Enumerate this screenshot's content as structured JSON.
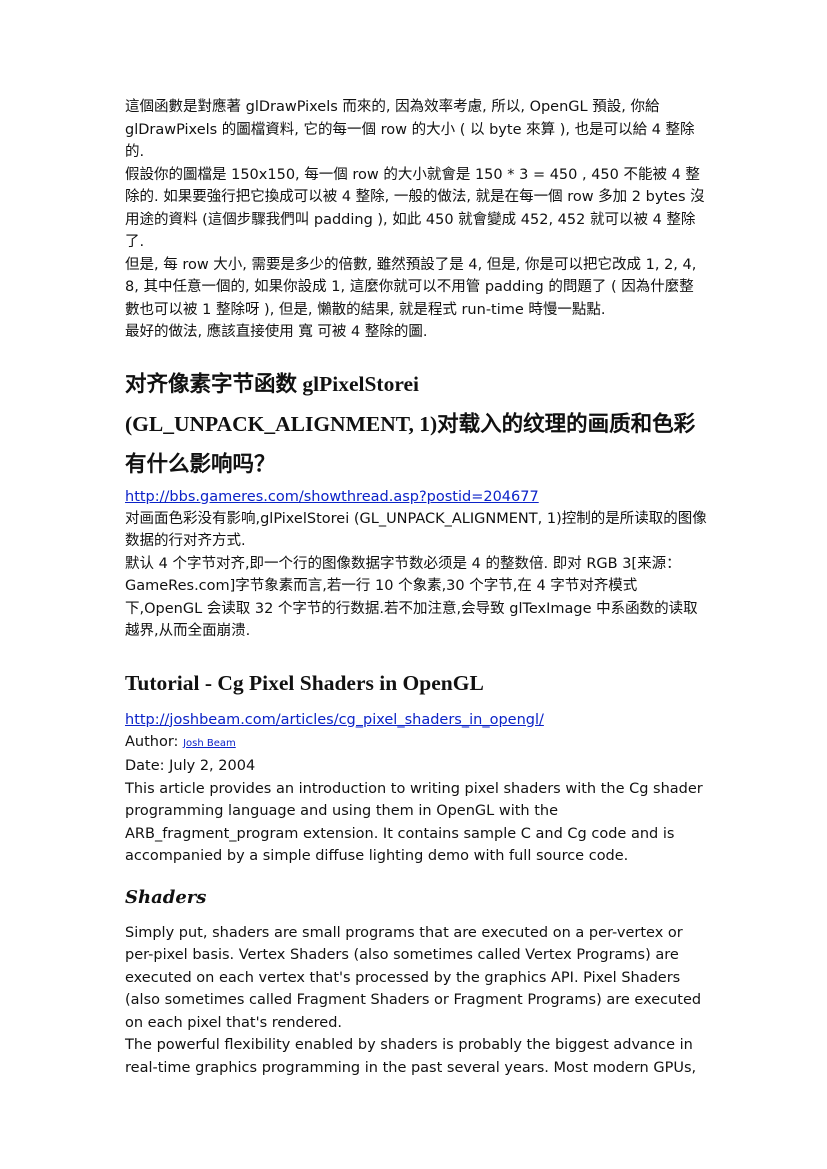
{
  "section1": {
    "paragraphs": [
      "這個函數是對應著 glDrawPixels 而來的, 因為效率考慮, 所以, OpenGL 預設, 你給 glDrawPixels 的圖檔資料, 它的每一個 row 的大小 ( 以 byte 來算 ), 也是可以給 4 整除的.",
      "假設你的圖檔是 150x150, 每一個 row 的大小就會是 150 * 3 = 450 , 450 不能被 4 整除的. 如果要強行把它換成可以被 4 整除, 一般的做法, 就是在每一個 row 多加 2 bytes 沒用途的資料 (這個步驟我們叫 padding ), 如此 450 就會變成 452, 452 就可以被 4 整除了.",
      "但是, 每 row 大小, 需要是多少的倍數, 雖然預設了是 4, 但是, 你是可以把它改成 1, 2, 4, 8, 其中任意一個的, 如果你設成 1, 這麼你就可以不用管 padding 的問題了 ( 因為什麼整數也可以被 1 整除呀 ), 但是, 懶散的結果, 就是程式 run-time 時慢一點點.",
      "最好的做法, 應該直接使用 寬 可被 4 整除的圖."
    ]
  },
  "section2": {
    "title": "对齐像素字节函数 glPixelStorei (GL_UNPACK_ALIGNMENT, 1)对载入的纹理的画质和色彩有什么影响吗？",
    "link": "http://bbs.gameres.com/showthread.asp?postid=204677",
    "paragraphs": [
      "对画面色彩没有影响,glPixelStorei (GL_UNPACK_ALIGNMENT, 1)控制的是所读取的图像数据的行对齐方式.",
      "默认 4 个字节对齐,即一个行的图像数据字节数必须是 4 的整数倍. 即对 RGB 3[来源：GameRes.com]字节象素而言,若一行 10 个象素,30 个字节,在 4 字节对齐模式下,OpenGL 会读取 32 个字节的行数据.若不加注意,会导致 glTexImage 中系函数的读取越界,从而全面崩溃."
    ]
  },
  "section3": {
    "title": "Tutorial - Cg Pixel Shaders in OpenGL",
    "link": "http://joshbeam.com/articles/cg_pixel_shaders_in_opengl/",
    "author_label": "Author:",
    "author_name": "Josh Beam",
    "date": "Date: July 2, 2004",
    "intro": "This article provides an introduction to writing pixel shaders with the Cg shader programming language and using them in OpenGL with the ARB_fragment_program extension. It contains sample C and Cg code and is accompanied by a simple diffuse lighting demo with full source code.",
    "shaders_title": "Shaders",
    "shaders_paragraphs": [
      "Simply put, shaders are small programs that are executed on a per-vertex or per-pixel basis. Vertex Shaders (also sometimes called Vertex Programs) are executed on each vertex that's processed by the graphics API. Pixel Shaders (also sometimes called Fragment Shaders or Fragment Programs) are executed on each pixel that's rendered.",
      "The powerful flexibility enabled by shaders is probably the biggest advance in real-time graphics programming in the past several years. Most modern GPUs,"
    ]
  }
}
